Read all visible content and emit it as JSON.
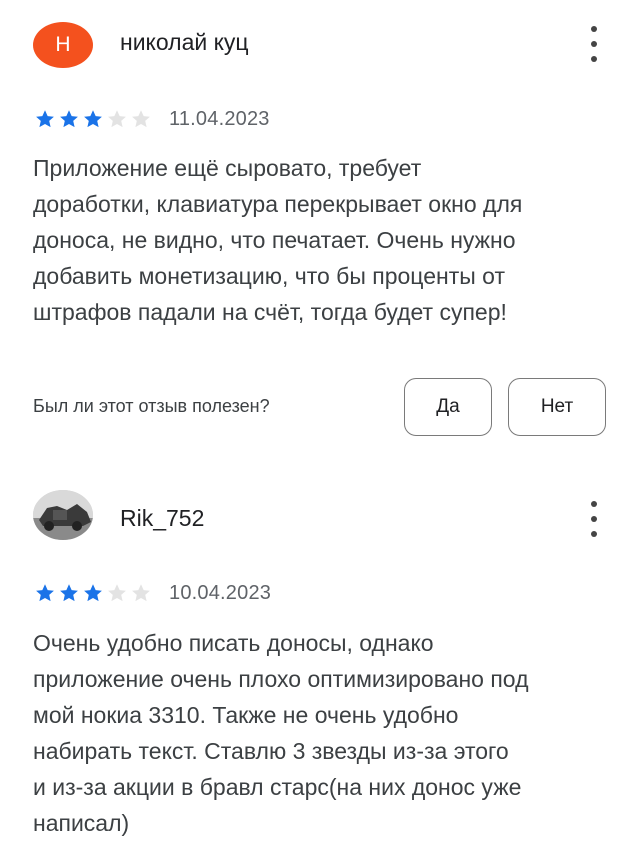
{
  "reviews": [
    {
      "author": "николай куц",
      "avatar_letter": "Н",
      "avatar_color": "#f4511e",
      "rating": 3,
      "max_rating": 5,
      "date": "11.04.2023",
      "text": "Приложение ещё сыровато, требует\nдоработки, клавиатура перекрывает окно для\nдоноса, не видно, что печатает. Очень нужно\nдобавить монетизацию, что бы проценты от\nштрафов падали на счёт, тогда будет супер!",
      "helpful_question": "Был ли этот отзыв полезен?",
      "yes_label": "Да",
      "no_label": "Нет"
    },
    {
      "author": "Rik_752",
      "avatar_icon": "photo-avatar-icon",
      "rating": 3,
      "max_rating": 5,
      "date": "10.04.2023",
      "text": "Очень удобно писать доносы, однако\nприложение очень плохо оптимизировано под\nмой нокиа 3310. Также не очень удобно\nнабирать текст. Ставлю 3 звезды из-за этого\nи из-за акции в бравл старс(на них донос уже\nнаписал)"
    }
  ],
  "colors": {
    "star_filled": "#1a73e8",
    "star_empty": "#e3e3e3"
  },
  "icons": {
    "more": "more-vert-icon",
    "star": "star-icon"
  }
}
